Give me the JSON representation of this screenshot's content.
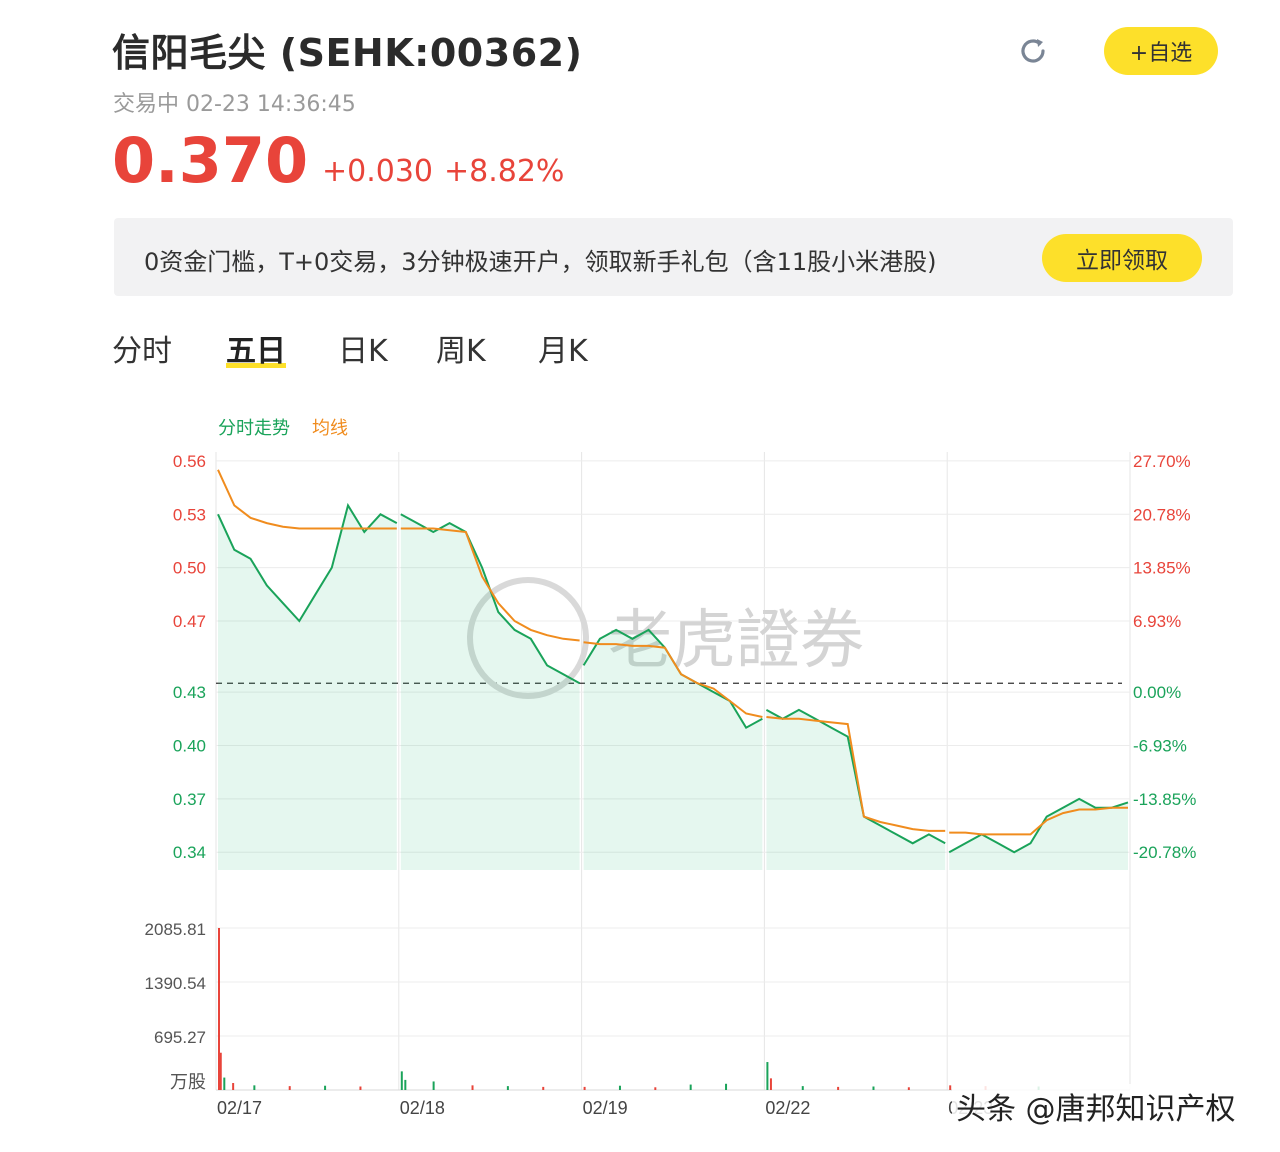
{
  "header": {
    "title": "信阳毛尖 (SEHK:00362)",
    "status": "交易中 02-23 14:36:45",
    "price": "0.370",
    "change": "+0.030",
    "change_pct": "+8.82%",
    "watch_label": "+自选",
    "refresh_icon": "refresh-icon"
  },
  "promo": {
    "text": "0资金门槛，T+0交易，3分钟极速开户，领取新手礼包（含11股小米港股)",
    "button": "立即领取"
  },
  "tabs": [
    {
      "label": "分时",
      "active": false
    },
    {
      "label": "五日",
      "active": true
    },
    {
      "label": "日K",
      "active": false
    },
    {
      "label": "周K",
      "active": false
    },
    {
      "label": "月K",
      "active": false
    }
  ],
  "colors": {
    "up": "#e8443a",
    "down": "#1aa35a",
    "avg": "#f08c1e",
    "accent": "#fde02a"
  },
  "chart_data": {
    "type": "line",
    "legend": [
      "分时走势",
      "均线"
    ],
    "watermark": "老虎證券",
    "x_labels": [
      "02/17",
      "02/18",
      "02/19",
      "02/22",
      "02/23"
    ],
    "y_ticks": [
      "0.56",
      "0.53",
      "0.50",
      "0.47",
      "0.43",
      "0.40",
      "0.37",
      "0.34"
    ],
    "y_tick_values": [
      0.56,
      0.53,
      0.5,
      0.47,
      0.43,
      0.4,
      0.37,
      0.34
    ],
    "pct_ticks": [
      "27.70%",
      "20.78%",
      "13.85%",
      "6.93%",
      "0.00%",
      "-6.93%",
      "-13.85%",
      "-20.78%"
    ],
    "prev_close": 0.435,
    "ylim": [
      0.33,
      0.565
    ],
    "series": [
      {
        "name": "分时走势",
        "values": [
          0.53,
          0.51,
          0.505,
          0.49,
          0.48,
          0.47,
          0.485,
          0.5,
          0.535,
          0.52,
          0.53,
          0.525,
          0.53,
          0.525,
          0.52,
          0.525,
          0.52,
          0.5,
          0.475,
          0.465,
          0.46,
          0.445,
          0.44,
          0.435,
          0.445,
          0.46,
          0.465,
          0.46,
          0.465,
          0.455,
          0.44,
          0.435,
          0.43,
          0.425,
          0.41,
          0.415,
          0.42,
          0.415,
          0.42,
          0.415,
          0.41,
          0.405,
          0.36,
          0.355,
          0.35,
          0.345,
          0.35,
          0.345,
          0.34,
          0.345,
          0.35,
          0.345,
          0.34,
          0.345,
          0.36,
          0.365,
          0.37,
          0.365,
          0.365,
          0.368
        ]
      },
      {
        "name": "均线",
        "values": [
          0.555,
          0.535,
          0.528,
          0.525,
          0.523,
          0.522,
          0.522,
          0.522,
          0.522,
          0.522,
          0.522,
          0.522,
          0.522,
          0.522,
          0.522,
          0.521,
          0.52,
          0.495,
          0.48,
          0.47,
          0.465,
          0.462,
          0.46,
          0.459,
          0.458,
          0.457,
          0.457,
          0.456,
          0.456,
          0.455,
          0.44,
          0.435,
          0.432,
          0.425,
          0.418,
          0.416,
          0.416,
          0.415,
          0.415,
          0.414,
          0.413,
          0.412,
          0.36,
          0.357,
          0.355,
          0.353,
          0.352,
          0.352,
          0.351,
          0.351,
          0.35,
          0.35,
          0.35,
          0.35,
          0.358,
          0.362,
          0.364,
          0.364,
          0.365,
          0.365
        ]
      }
    ],
    "volume": {
      "unit": "万股",
      "ticks": [
        "2085.81",
        "1390.54",
        "695.27"
      ],
      "tick_values": [
        2085.81,
        1390.54,
        695.27
      ],
      "max": 2085.81,
      "bars": [
        {
          "day": 0,
          "pos": 0.0,
          "value": 2085.81,
          "dir": "up"
        },
        {
          "day": 0,
          "pos": 0.01,
          "value": 480,
          "dir": "up"
        },
        {
          "day": 0,
          "pos": 0.03,
          "value": 160,
          "dir": "down"
        },
        {
          "day": 0,
          "pos": 0.08,
          "value": 90,
          "dir": "up"
        },
        {
          "day": 0,
          "pos": 0.2,
          "value": 60,
          "dir": "down"
        },
        {
          "day": 0,
          "pos": 0.4,
          "value": 50,
          "dir": "up"
        },
        {
          "day": 0,
          "pos": 0.6,
          "value": 55,
          "dir": "down"
        },
        {
          "day": 0,
          "pos": 0.8,
          "value": 45,
          "dir": "up"
        },
        {
          "day": 1,
          "pos": 0.0,
          "value": 240,
          "dir": "down"
        },
        {
          "day": 1,
          "pos": 0.02,
          "value": 130,
          "dir": "down"
        },
        {
          "day": 1,
          "pos": 0.18,
          "value": 110,
          "dir": "down"
        },
        {
          "day": 1,
          "pos": 0.4,
          "value": 60,
          "dir": "up"
        },
        {
          "day": 1,
          "pos": 0.6,
          "value": 50,
          "dir": "down"
        },
        {
          "day": 1,
          "pos": 0.8,
          "value": 40,
          "dir": "up"
        },
        {
          "day": 2,
          "pos": 0.0,
          "value": 40,
          "dir": "up"
        },
        {
          "day": 2,
          "pos": 0.2,
          "value": 55,
          "dir": "down"
        },
        {
          "day": 2,
          "pos": 0.4,
          "value": 35,
          "dir": "up"
        },
        {
          "day": 2,
          "pos": 0.6,
          "value": 70,
          "dir": "down"
        },
        {
          "day": 2,
          "pos": 0.8,
          "value": 80,
          "dir": "down"
        },
        {
          "day": 3,
          "pos": 0.0,
          "value": 360,
          "dir": "down"
        },
        {
          "day": 3,
          "pos": 0.02,
          "value": 150,
          "dir": "up"
        },
        {
          "day": 3,
          "pos": 0.2,
          "value": 50,
          "dir": "down"
        },
        {
          "day": 3,
          "pos": 0.4,
          "value": 40,
          "dir": "up"
        },
        {
          "day": 3,
          "pos": 0.6,
          "value": 45,
          "dir": "down"
        },
        {
          "day": 3,
          "pos": 0.8,
          "value": 35,
          "dir": "up"
        },
        {
          "day": 4,
          "pos": 0.0,
          "value": 60,
          "dir": "up"
        },
        {
          "day": 4,
          "pos": 0.2,
          "value": 50,
          "dir": "up"
        },
        {
          "day": 4,
          "pos": 0.5,
          "value": 45,
          "dir": "down"
        }
      ]
    }
  },
  "footer": {
    "watermark": "头条 @唐邦知识产权"
  }
}
